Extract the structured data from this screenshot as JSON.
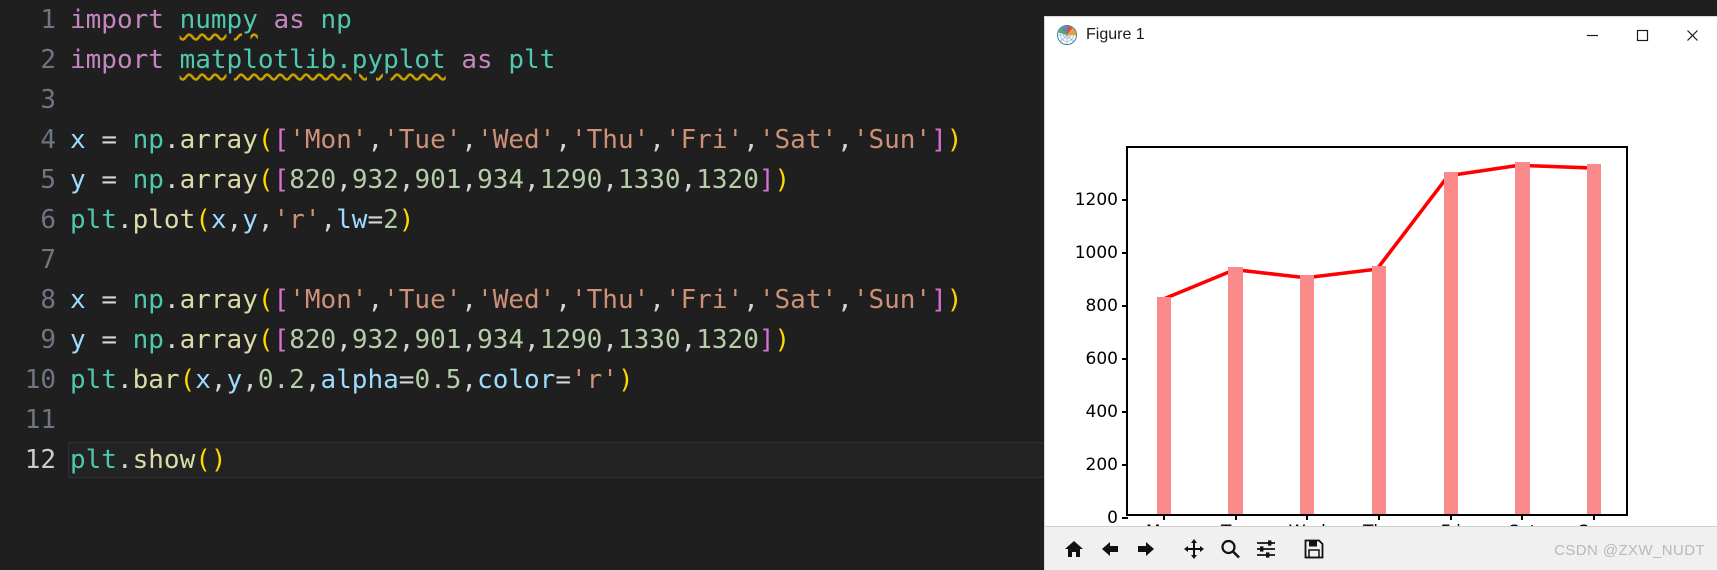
{
  "editor": {
    "lines": [
      {
        "num": "1",
        "active": false,
        "tokens": [
          {
            "t": "import",
            "c": "t-kw"
          },
          {
            "t": " ",
            "c": "t-plain"
          },
          {
            "t": "numpy",
            "c": "t-mod squiggle"
          },
          {
            "t": " ",
            "c": "t-plain"
          },
          {
            "t": "as",
            "c": "t-kw"
          },
          {
            "t": " ",
            "c": "t-plain"
          },
          {
            "t": "np",
            "c": "t-mod"
          }
        ]
      },
      {
        "num": "2",
        "active": false,
        "tokens": [
          {
            "t": "import",
            "c": "t-kw"
          },
          {
            "t": " ",
            "c": "t-plain"
          },
          {
            "t": "matplotlib.pyplot",
            "c": "t-mod squiggle"
          },
          {
            "t": " ",
            "c": "t-plain"
          },
          {
            "t": "as",
            "c": "t-kw"
          },
          {
            "t": " ",
            "c": "t-plain"
          },
          {
            "t": "plt",
            "c": "t-mod"
          }
        ]
      },
      {
        "num": "3",
        "active": false,
        "tokens": []
      },
      {
        "num": "4",
        "active": false,
        "tokens": [
          {
            "t": "x",
            "c": "t-var"
          },
          {
            "t": " ",
            "c": "t-plain"
          },
          {
            "t": "=",
            "c": "t-op"
          },
          {
            "t": " ",
            "c": "t-plain"
          },
          {
            "t": "np",
            "c": "t-mod"
          },
          {
            "t": ".",
            "c": "t-punct"
          },
          {
            "t": "array",
            "c": "t-fn"
          },
          {
            "t": "(",
            "c": "t-par1"
          },
          {
            "t": "[",
            "c": "t-par2"
          },
          {
            "t": "'Mon'",
            "c": "t-str"
          },
          {
            "t": ",",
            "c": "t-punct"
          },
          {
            "t": "'Tue'",
            "c": "t-str"
          },
          {
            "t": ",",
            "c": "t-punct"
          },
          {
            "t": "'Wed'",
            "c": "t-str"
          },
          {
            "t": ",",
            "c": "t-punct"
          },
          {
            "t": "'Thu'",
            "c": "t-str"
          },
          {
            "t": ",",
            "c": "t-punct"
          },
          {
            "t": "'Fri'",
            "c": "t-str"
          },
          {
            "t": ",",
            "c": "t-punct"
          },
          {
            "t": "'Sat'",
            "c": "t-str"
          },
          {
            "t": ",",
            "c": "t-punct"
          },
          {
            "t": "'Sun'",
            "c": "t-str"
          },
          {
            "t": "]",
            "c": "t-par2"
          },
          {
            "t": ")",
            "c": "t-par1"
          }
        ]
      },
      {
        "num": "5",
        "active": false,
        "tokens": [
          {
            "t": "y",
            "c": "t-var"
          },
          {
            "t": " ",
            "c": "t-plain"
          },
          {
            "t": "=",
            "c": "t-op"
          },
          {
            "t": " ",
            "c": "t-plain"
          },
          {
            "t": "np",
            "c": "t-mod"
          },
          {
            "t": ".",
            "c": "t-punct"
          },
          {
            "t": "array",
            "c": "t-fn"
          },
          {
            "t": "(",
            "c": "t-par1"
          },
          {
            "t": "[",
            "c": "t-par2"
          },
          {
            "t": "820",
            "c": "t-num"
          },
          {
            "t": ",",
            "c": "t-punct"
          },
          {
            "t": "932",
            "c": "t-num"
          },
          {
            "t": ",",
            "c": "t-punct"
          },
          {
            "t": "901",
            "c": "t-num"
          },
          {
            "t": ",",
            "c": "t-punct"
          },
          {
            "t": "934",
            "c": "t-num"
          },
          {
            "t": ",",
            "c": "t-punct"
          },
          {
            "t": "1290",
            "c": "t-num"
          },
          {
            "t": ",",
            "c": "t-punct"
          },
          {
            "t": "1330",
            "c": "t-num"
          },
          {
            "t": ",",
            "c": "t-punct"
          },
          {
            "t": "1320",
            "c": "t-num"
          },
          {
            "t": "]",
            "c": "t-par2"
          },
          {
            "t": ")",
            "c": "t-par1"
          }
        ]
      },
      {
        "num": "6",
        "active": false,
        "tokens": [
          {
            "t": "plt",
            "c": "t-mod"
          },
          {
            "t": ".",
            "c": "t-punct"
          },
          {
            "t": "plot",
            "c": "t-fn"
          },
          {
            "t": "(",
            "c": "t-par1"
          },
          {
            "t": "x",
            "c": "t-var"
          },
          {
            "t": ",",
            "c": "t-punct"
          },
          {
            "t": "y",
            "c": "t-var"
          },
          {
            "t": ",",
            "c": "t-punct"
          },
          {
            "t": "'r'",
            "c": "t-str"
          },
          {
            "t": ",",
            "c": "t-punct"
          },
          {
            "t": "lw",
            "c": "t-var"
          },
          {
            "t": "=",
            "c": "t-op"
          },
          {
            "t": "2",
            "c": "t-num"
          },
          {
            "t": ")",
            "c": "t-par1"
          }
        ]
      },
      {
        "num": "7",
        "active": false,
        "tokens": []
      },
      {
        "num": "8",
        "active": false,
        "tokens": [
          {
            "t": "x",
            "c": "t-var"
          },
          {
            "t": " ",
            "c": "t-plain"
          },
          {
            "t": "=",
            "c": "t-op"
          },
          {
            "t": " ",
            "c": "t-plain"
          },
          {
            "t": "np",
            "c": "t-mod"
          },
          {
            "t": ".",
            "c": "t-punct"
          },
          {
            "t": "array",
            "c": "t-fn"
          },
          {
            "t": "(",
            "c": "t-par1"
          },
          {
            "t": "[",
            "c": "t-par2"
          },
          {
            "t": "'Mon'",
            "c": "t-str"
          },
          {
            "t": ",",
            "c": "t-punct"
          },
          {
            "t": "'Tue'",
            "c": "t-str"
          },
          {
            "t": ",",
            "c": "t-punct"
          },
          {
            "t": "'Wed'",
            "c": "t-str"
          },
          {
            "t": ",",
            "c": "t-punct"
          },
          {
            "t": "'Thu'",
            "c": "t-str"
          },
          {
            "t": ",",
            "c": "t-punct"
          },
          {
            "t": "'Fri'",
            "c": "t-str"
          },
          {
            "t": ",",
            "c": "t-punct"
          },
          {
            "t": "'Sat'",
            "c": "t-str"
          },
          {
            "t": ",",
            "c": "t-punct"
          },
          {
            "t": "'Sun'",
            "c": "t-str"
          },
          {
            "t": "]",
            "c": "t-par2"
          },
          {
            "t": ")",
            "c": "t-par1"
          }
        ]
      },
      {
        "num": "9",
        "active": false,
        "tokens": [
          {
            "t": "y",
            "c": "t-var"
          },
          {
            "t": " ",
            "c": "t-plain"
          },
          {
            "t": "=",
            "c": "t-op"
          },
          {
            "t": " ",
            "c": "t-plain"
          },
          {
            "t": "np",
            "c": "t-mod"
          },
          {
            "t": ".",
            "c": "t-punct"
          },
          {
            "t": "array",
            "c": "t-fn"
          },
          {
            "t": "(",
            "c": "t-par1"
          },
          {
            "t": "[",
            "c": "t-par2"
          },
          {
            "t": "820",
            "c": "t-num"
          },
          {
            "t": ",",
            "c": "t-punct"
          },
          {
            "t": "932",
            "c": "t-num"
          },
          {
            "t": ",",
            "c": "t-punct"
          },
          {
            "t": "901",
            "c": "t-num"
          },
          {
            "t": ",",
            "c": "t-punct"
          },
          {
            "t": "934",
            "c": "t-num"
          },
          {
            "t": ",",
            "c": "t-punct"
          },
          {
            "t": "1290",
            "c": "t-num"
          },
          {
            "t": ",",
            "c": "t-punct"
          },
          {
            "t": "1330",
            "c": "t-num"
          },
          {
            "t": ",",
            "c": "t-punct"
          },
          {
            "t": "1320",
            "c": "t-num"
          },
          {
            "t": "]",
            "c": "t-par2"
          },
          {
            "t": ")",
            "c": "t-par1"
          }
        ]
      },
      {
        "num": "10",
        "active": false,
        "tokens": [
          {
            "t": "plt",
            "c": "t-mod"
          },
          {
            "t": ".",
            "c": "t-punct"
          },
          {
            "t": "bar",
            "c": "t-fn"
          },
          {
            "t": "(",
            "c": "t-par1"
          },
          {
            "t": "x",
            "c": "t-var"
          },
          {
            "t": ",",
            "c": "t-punct"
          },
          {
            "t": "y",
            "c": "t-var"
          },
          {
            "t": ",",
            "c": "t-punct"
          },
          {
            "t": "0.2",
            "c": "t-num"
          },
          {
            "t": ",",
            "c": "t-punct"
          },
          {
            "t": "alpha",
            "c": "t-var"
          },
          {
            "t": "=",
            "c": "t-op"
          },
          {
            "t": "0.5",
            "c": "t-num"
          },
          {
            "t": ",",
            "c": "t-punct"
          },
          {
            "t": "color",
            "c": "t-var"
          },
          {
            "t": "=",
            "c": "t-op"
          },
          {
            "t": "'r'",
            "c": "t-str"
          },
          {
            "t": ")",
            "c": "t-par1"
          }
        ]
      },
      {
        "num": "11",
        "active": false,
        "tokens": []
      },
      {
        "num": "12",
        "active": true,
        "tokens": [
          {
            "t": "plt",
            "c": "t-mod"
          },
          {
            "t": ".",
            "c": "t-punct"
          },
          {
            "t": "show",
            "c": "t-fn"
          },
          {
            "t": "(",
            "c": "t-par1"
          },
          {
            "t": ")",
            "c": "t-par1"
          }
        ]
      }
    ]
  },
  "figure_window": {
    "title": "Figure 1",
    "icon": "matplotlib-logo-icon",
    "controls": [
      {
        "name": "minimize",
        "glyph": "—"
      },
      {
        "name": "maximize",
        "glyph": "□"
      },
      {
        "name": "close",
        "glyph": "✕"
      }
    ],
    "toolbar": {
      "buttons": [
        {
          "name": "home-icon",
          "tooltip": "Reset original view"
        },
        {
          "name": "back-arrow-icon",
          "tooltip": "Back to previous view"
        },
        {
          "name": "forward-arrow-icon",
          "tooltip": "Forward to next view"
        },
        {
          "name": "pan-move-icon",
          "tooltip": "Pan axes with left mouse, zoom with right"
        },
        {
          "name": "zoom-magnifier-icon",
          "tooltip": "Zoom to rectangle"
        },
        {
          "name": "configure-subplots-icon",
          "tooltip": "Configure subplots"
        },
        {
          "name": "save-floppy-icon",
          "tooltip": "Save the figure"
        }
      ]
    },
    "watermark": "CSDN @ZXW_NUDT"
  },
  "chart_data": {
    "type": "bar",
    "title": "",
    "xlabel": "",
    "ylabel": "",
    "categories": [
      "Mon",
      "Tue",
      "Wed",
      "Thu",
      "Fri",
      "Sat",
      "Sun"
    ],
    "ylim": [
      0,
      1396
    ],
    "yticks": [
      0,
      200,
      400,
      600,
      800,
      1000,
      1200
    ],
    "ytick_labels": [
      "0",
      "200",
      "400",
      "600",
      "800",
      "1000",
      "1200"
    ],
    "grid": false,
    "legend": null,
    "series": [
      {
        "name": "bars",
        "kind": "bar",
        "color": "#fa8989",
        "alpha": 0.5,
        "width": 0.2,
        "values": [
          820,
          932,
          901,
          934,
          1290,
          1330,
          1320
        ]
      },
      {
        "name": "line",
        "kind": "line",
        "color": "#ff0000",
        "linewidth": 2,
        "values": [
          820,
          932,
          901,
          934,
          1290,
          1330,
          1320
        ]
      }
    ]
  }
}
